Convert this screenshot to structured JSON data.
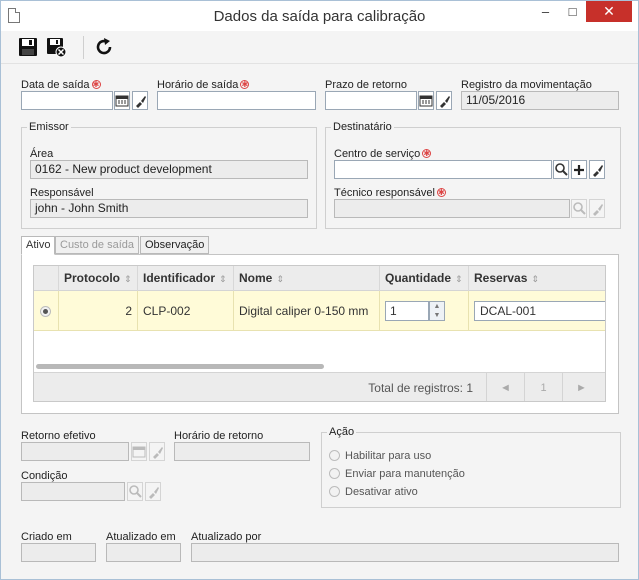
{
  "window": {
    "title": "Dados da saída para calibração"
  },
  "toolbar": {
    "save": "save-icon",
    "save_close": "save-close-icon",
    "refresh": "refresh-icon"
  },
  "fields": {
    "data_saida": {
      "label": "Data de saída",
      "value": ""
    },
    "horario_saida": {
      "label": "Horário de saída",
      "value": ""
    },
    "prazo_retorno": {
      "label": "Prazo de retorno",
      "value": ""
    },
    "registro_movimentacao": {
      "label": "Registro da movimentação",
      "value": "11/05/2016"
    }
  },
  "emissor": {
    "legend": "Emissor",
    "area_label": "Área",
    "area_value": "0162 - New product development",
    "responsavel_label": "Responsável",
    "responsavel_value": "john - John Smith"
  },
  "destinatario": {
    "legend": "Destinatário",
    "centro_label": "Centro de serviço",
    "centro_value": "",
    "tecnico_label": "Técnico responsável",
    "tecnico_value": ""
  },
  "tabs": [
    {
      "label": "Ativo"
    },
    {
      "label": "Custo de saída"
    },
    {
      "label": "Observação"
    }
  ],
  "grid": {
    "columns": [
      "Protocolo",
      "Identificador",
      "Nome",
      "Quantidade",
      "Reservas"
    ],
    "rows": [
      {
        "protocolo": "2",
        "identificador": "CLP-002",
        "nome": "Digital caliper 0-150 mm",
        "quantidade": "1",
        "reservas": "DCAL-001"
      }
    ],
    "total_label": "Total de registros: 1",
    "prev": "◄",
    "page": "1",
    "next": "►"
  },
  "retorno": {
    "retorno_efetivo_label": "Retorno efetivo",
    "horario_retorno_label": "Horário de retorno",
    "condicao_label": "Condição"
  },
  "acao": {
    "legend": "Ação",
    "options": [
      "Habilitar para uso",
      "Enviar para manutenção",
      "Desativar ativo"
    ]
  },
  "audit": {
    "criado_em_label": "Criado em",
    "atualizado_em_label": "Atualizado em",
    "atualizado_por_label": "Atualizado por"
  },
  "colors": {
    "accent": "#c7302a",
    "row_highlight": "#fffbd8",
    "required": "#dd4444"
  }
}
